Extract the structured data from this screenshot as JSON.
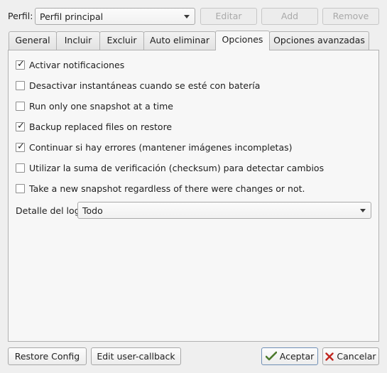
{
  "profile": {
    "label": "Perfil:",
    "selected": "Perfil principal",
    "edit_label": "Editar",
    "add_label": "Add",
    "remove_label": "Remove"
  },
  "tabs": [
    {
      "label": "General"
    },
    {
      "label": "Incluir"
    },
    {
      "label": "Excluir"
    },
    {
      "label": "Auto eliminar"
    },
    {
      "label": "Opciones"
    },
    {
      "label": "Opciones avanzadas"
    }
  ],
  "options": [
    {
      "label": "Activar notificaciones",
      "checked": true,
      "tick": "✓"
    },
    {
      "label": "Desactivar instantáneas cuando se esté con batería",
      "checked": false,
      "tick": ""
    },
    {
      "label": "Run only one snapshot at a time",
      "checked": false,
      "tick": ""
    },
    {
      "label": "Backup replaced files on restore",
      "checked": true,
      "tick": "✓"
    },
    {
      "label": "Continuar si hay errores (mantener imágenes incompletas)",
      "checked": true,
      "tick": "✓"
    },
    {
      "label": "Utilizar la suma de verificación (checksum) para detectar cambios",
      "checked": false,
      "tick": ""
    },
    {
      "label": "Take a new snapshot regardless of there were changes or not.",
      "checked": false,
      "tick": ""
    }
  ],
  "log_detail": {
    "label": "Detalle del log",
    "selected": "Todo"
  },
  "footer": {
    "restore_config": "Restore Config",
    "edit_callback": "Edit user-callback",
    "accept": "Aceptar",
    "cancel": "Cancelar"
  }
}
